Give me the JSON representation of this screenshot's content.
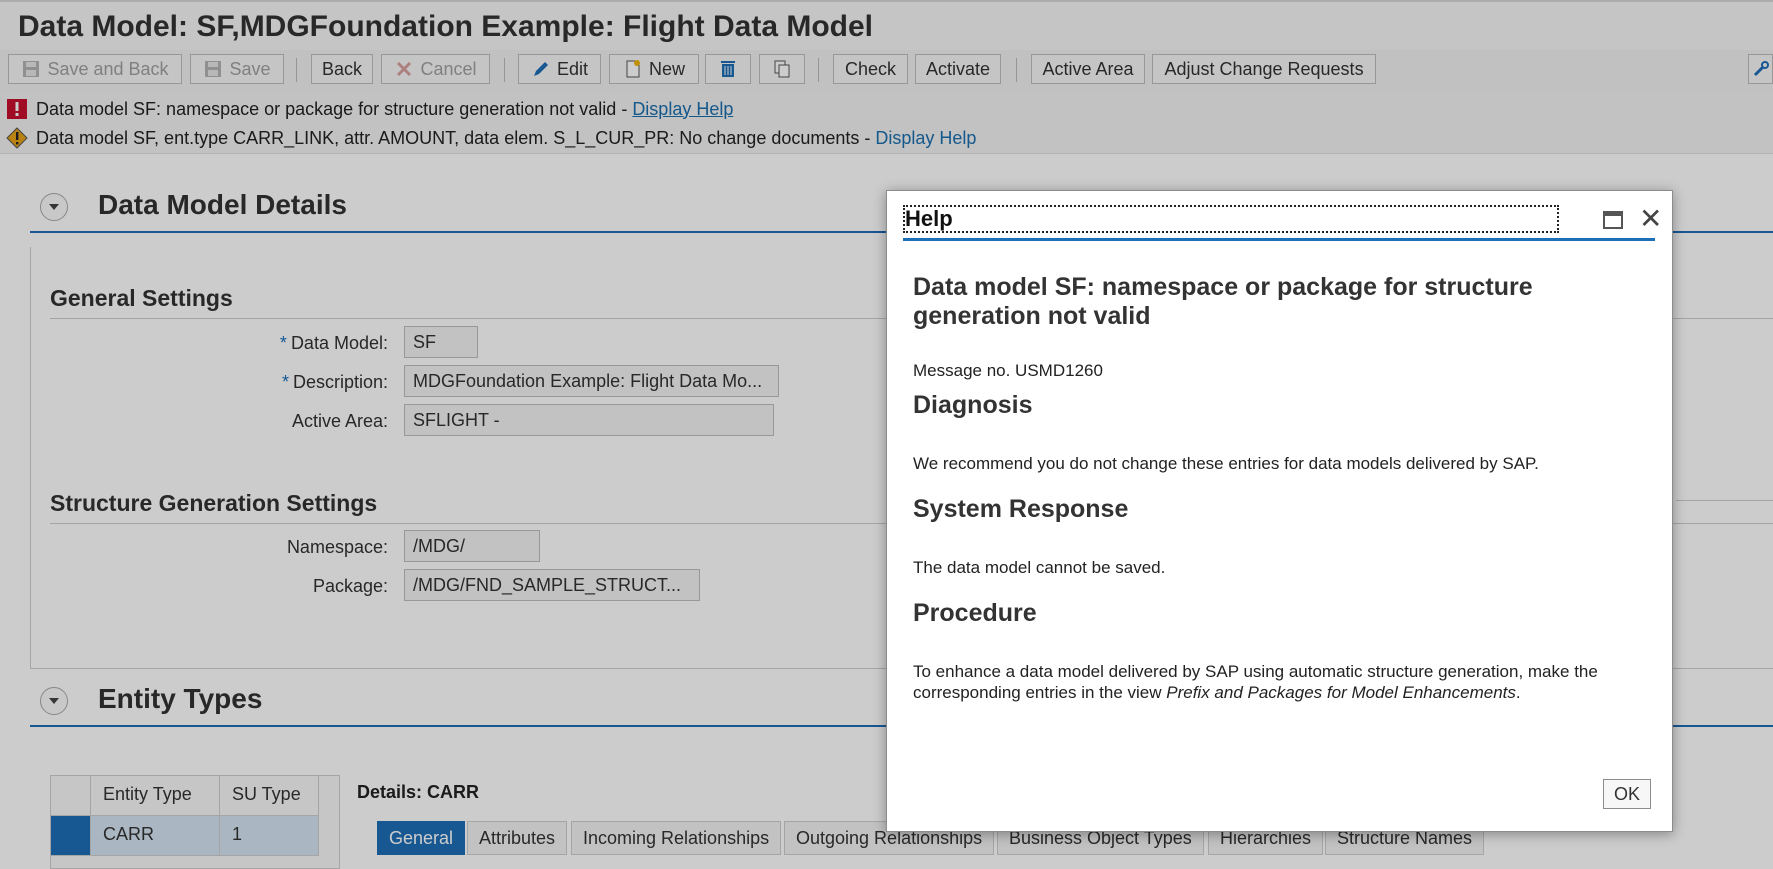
{
  "page": {
    "title": "Data Model: SF,MDGFoundation Example: Flight Data Model"
  },
  "toolbar": {
    "save_and_back": "Save and Back",
    "save": "Save",
    "back": "Back",
    "cancel": "Cancel",
    "edit": "Edit",
    "new": "New",
    "check": "Check",
    "activate": "Activate",
    "active_area": "Active Area",
    "adjust_change_requests": "Adjust Change Requests"
  },
  "messages": [
    {
      "type": "error",
      "text": "Data model SF: namespace or package for structure generation not valid - ",
      "link": "Display Help"
    },
    {
      "type": "warning",
      "text": "Data model SF, ent.type CARR_LINK, attr. AMOUNT, data elem. S_L_CUR_PR: No change documents - ",
      "link": "Display Help"
    }
  ],
  "details": {
    "section_title": "Data Model Details",
    "general_settings": "General Settings",
    "data_model_label": "Data Model:",
    "data_model_value": "SF",
    "description_label": "Description:",
    "description_value": "MDGFoundation Example: Flight Data Mo...",
    "active_area_label": "Active Area:",
    "active_area_value": "SFLIGHT -",
    "structure_settings": "Structure Generation Settings",
    "namespace_label": "Namespace:",
    "namespace_value": "/MDG/",
    "package_label": "Package:",
    "package_value": "/MDG/FND_SAMPLE_STRUCT..."
  },
  "entity_types": {
    "section_title": "Entity Types",
    "columns": [
      "Entity Type",
      "SU Type"
    ],
    "rows": [
      [
        "CARR",
        "1"
      ]
    ],
    "details_label": "Details: CARR",
    "tabs": [
      "General",
      "Attributes",
      "Incoming Relationships",
      "Outgoing Relationships",
      "Business Object Types",
      "Hierarchies",
      "Structure Names"
    ],
    "active_tab": "General"
  },
  "dialog": {
    "title": "Help",
    "heading": "Data model SF: namespace or package for structure generation not valid",
    "message_no": "Message no. USMD1260",
    "diagnosis_title": "Diagnosis",
    "diagnosis_text": "We recommend you do not change these entries for data models delivered by SAP.",
    "response_title": "System Response",
    "response_text": "The data model cannot be saved.",
    "procedure_title": "Procedure",
    "procedure_text": "To enhance a data model delivered by SAP using automatic structure generation, make the corresponding entries in the view ",
    "procedure_italic": "Prefix and Packages for Model Enhancements",
    "procedure_end": ".",
    "ok": "OK"
  },
  "colors": {
    "accent": "#1d6fb8",
    "error": "#c8102e",
    "warning": "#e8a317"
  }
}
